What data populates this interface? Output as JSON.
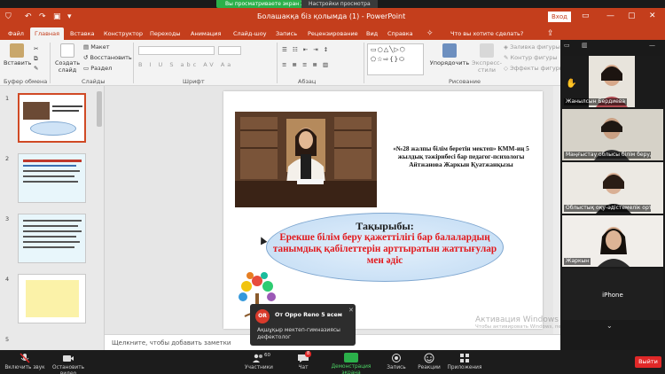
{
  "share_banner": {
    "status": "Вы просматриваете экран Жаркын",
    "options": "Настройки просмотра"
  },
  "window": {
    "title": "Болашакқа бiз қолымда (1) - PowerPoint",
    "signin": "Вход"
  },
  "ribbon_tabs": [
    "Файл",
    "Главная",
    "Вставка",
    "Конструктор",
    "Переходы",
    "Анимация",
    "Слайд-шоу",
    "Запись",
    "Рецензирование",
    "Вид",
    "Справка"
  ],
  "active_tab": "Главная",
  "tell_me": "Что вы хотите сделать?",
  "ribbon": {
    "paste": "Вставить",
    "new_slide": "Создать слайд",
    "layout": "Макет",
    "reset": "Восстановить",
    "section": "Раздел",
    "arrange": "Упорядочить",
    "quick_styles": "Экспресс-стили",
    "shape_fill": "Заливка фигуры",
    "shape_outline": "Контур фигуры",
    "shape_effects": "Эффекты фигуры",
    "groups": {
      "clipboard": "Буфер обмена",
      "slides": "Слайды",
      "font": "Шрифт",
      "paragraph": "Абзац",
      "drawing": "Рисование"
    }
  },
  "thumbnails": [
    {
      "num": "1",
      "selected": true
    },
    {
      "num": "2",
      "selected": false
    },
    {
      "num": "3",
      "selected": false
    },
    {
      "num": "4",
      "selected": false
    },
    {
      "num": "5",
      "selected": false
    }
  ],
  "slide": {
    "caption": "«№28 жалпы бiлiм беретiн мектеп» КММ-иң 5 жылдық тәжiрибесi бар педагог-психологы Айтжанова Жаркын Қуатжанқызы",
    "topic_heading": "Тақырыбы:",
    "topic_body": "Ерекше бiлiм беру қажеттiлiгi бар балалардың танымдық қабiлеттерiн арттыратын жаттығулар мен әдiс"
  },
  "notes_placeholder": "Щелкните, чтобы добавить заметки",
  "watermark": {
    "title": "Активация Windows",
    "sub": "Чтобы активировать Windows, перейдите в параметрам компьютера."
  },
  "gallery": [
    {
      "name": "Жанылсын Бердиева"
    },
    {
      "name": "Маңғыстау облысы бiлiм беруд..."
    },
    {
      "name": "Облыстық оқу-әдiстемелiк орталы..."
    },
    {
      "name": "Жаркын"
    }
  ],
  "gallery_extra": {
    "label": "iPhone"
  },
  "toast": {
    "avatar": "OR",
    "sender": "От Oppo Reno 5 всем",
    "message": "Ақшұқыр мектеп-гимназиясы дефектолог"
  },
  "zoom_bar": {
    "mic": "Включить звук",
    "video": "Остановить видео",
    "participants": "Участники",
    "participants_count": "60",
    "chat": "Чат",
    "chat_badge": "8",
    "share": "Демонстрация экрана",
    "record": "Запись",
    "reactions": "Реакции",
    "apps": "Приложения",
    "leave": "Выйти"
  },
  "colors": {
    "ppt_accent": "#c43e1c",
    "zoom_green": "#2bb04a",
    "topic_red": "#e2191d",
    "leave_red": "#e02828"
  }
}
